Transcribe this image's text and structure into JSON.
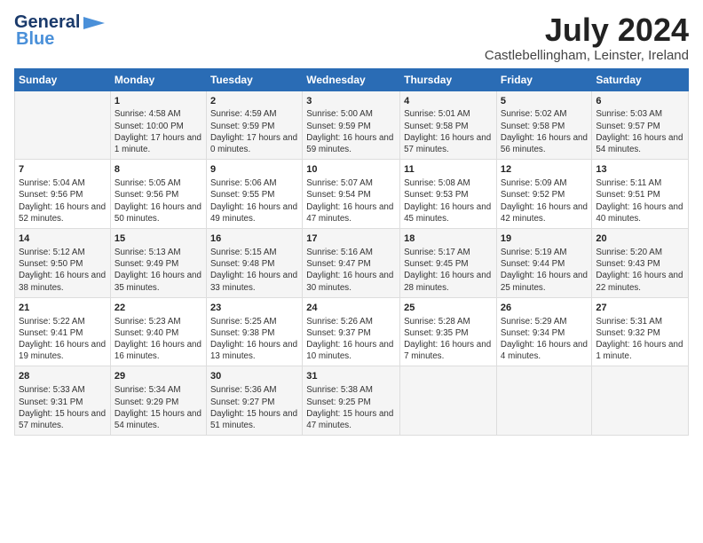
{
  "logo": {
    "line1": "General",
    "line2": "Blue"
  },
  "title": "July 2024",
  "subtitle": "Castlebellingham, Leinster, Ireland",
  "days_header": [
    "Sunday",
    "Monday",
    "Tuesday",
    "Wednesday",
    "Thursday",
    "Friday",
    "Saturday"
  ],
  "rows": [
    [
      {
        "day": "",
        "sunrise": "",
        "sunset": "",
        "daylight": ""
      },
      {
        "day": "1",
        "sunrise": "Sunrise: 4:58 AM",
        "sunset": "Sunset: 10:00 PM",
        "daylight": "Daylight: 17 hours and 1 minute."
      },
      {
        "day": "2",
        "sunrise": "Sunrise: 4:59 AM",
        "sunset": "Sunset: 9:59 PM",
        "daylight": "Daylight: 17 hours and 0 minutes."
      },
      {
        "day": "3",
        "sunrise": "Sunrise: 5:00 AM",
        "sunset": "Sunset: 9:59 PM",
        "daylight": "Daylight: 16 hours and 59 minutes."
      },
      {
        "day": "4",
        "sunrise": "Sunrise: 5:01 AM",
        "sunset": "Sunset: 9:58 PM",
        "daylight": "Daylight: 16 hours and 57 minutes."
      },
      {
        "day": "5",
        "sunrise": "Sunrise: 5:02 AM",
        "sunset": "Sunset: 9:58 PM",
        "daylight": "Daylight: 16 hours and 56 minutes."
      },
      {
        "day": "6",
        "sunrise": "Sunrise: 5:03 AM",
        "sunset": "Sunset: 9:57 PM",
        "daylight": "Daylight: 16 hours and 54 minutes."
      }
    ],
    [
      {
        "day": "7",
        "sunrise": "Sunrise: 5:04 AM",
        "sunset": "Sunset: 9:56 PM",
        "daylight": "Daylight: 16 hours and 52 minutes."
      },
      {
        "day": "8",
        "sunrise": "Sunrise: 5:05 AM",
        "sunset": "Sunset: 9:56 PM",
        "daylight": "Daylight: 16 hours and 50 minutes."
      },
      {
        "day": "9",
        "sunrise": "Sunrise: 5:06 AM",
        "sunset": "Sunset: 9:55 PM",
        "daylight": "Daylight: 16 hours and 49 minutes."
      },
      {
        "day": "10",
        "sunrise": "Sunrise: 5:07 AM",
        "sunset": "Sunset: 9:54 PM",
        "daylight": "Daylight: 16 hours and 47 minutes."
      },
      {
        "day": "11",
        "sunrise": "Sunrise: 5:08 AM",
        "sunset": "Sunset: 9:53 PM",
        "daylight": "Daylight: 16 hours and 45 minutes."
      },
      {
        "day": "12",
        "sunrise": "Sunrise: 5:09 AM",
        "sunset": "Sunset: 9:52 PM",
        "daylight": "Daylight: 16 hours and 42 minutes."
      },
      {
        "day": "13",
        "sunrise": "Sunrise: 5:11 AM",
        "sunset": "Sunset: 9:51 PM",
        "daylight": "Daylight: 16 hours and 40 minutes."
      }
    ],
    [
      {
        "day": "14",
        "sunrise": "Sunrise: 5:12 AM",
        "sunset": "Sunset: 9:50 PM",
        "daylight": "Daylight: 16 hours and 38 minutes."
      },
      {
        "day": "15",
        "sunrise": "Sunrise: 5:13 AM",
        "sunset": "Sunset: 9:49 PM",
        "daylight": "Daylight: 16 hours and 35 minutes."
      },
      {
        "day": "16",
        "sunrise": "Sunrise: 5:15 AM",
        "sunset": "Sunset: 9:48 PM",
        "daylight": "Daylight: 16 hours and 33 minutes."
      },
      {
        "day": "17",
        "sunrise": "Sunrise: 5:16 AM",
        "sunset": "Sunset: 9:47 PM",
        "daylight": "Daylight: 16 hours and 30 minutes."
      },
      {
        "day": "18",
        "sunrise": "Sunrise: 5:17 AM",
        "sunset": "Sunset: 9:45 PM",
        "daylight": "Daylight: 16 hours and 28 minutes."
      },
      {
        "day": "19",
        "sunrise": "Sunrise: 5:19 AM",
        "sunset": "Sunset: 9:44 PM",
        "daylight": "Daylight: 16 hours and 25 minutes."
      },
      {
        "day": "20",
        "sunrise": "Sunrise: 5:20 AM",
        "sunset": "Sunset: 9:43 PM",
        "daylight": "Daylight: 16 hours and 22 minutes."
      }
    ],
    [
      {
        "day": "21",
        "sunrise": "Sunrise: 5:22 AM",
        "sunset": "Sunset: 9:41 PM",
        "daylight": "Daylight: 16 hours and 19 minutes."
      },
      {
        "day": "22",
        "sunrise": "Sunrise: 5:23 AM",
        "sunset": "Sunset: 9:40 PM",
        "daylight": "Daylight: 16 hours and 16 minutes."
      },
      {
        "day": "23",
        "sunrise": "Sunrise: 5:25 AM",
        "sunset": "Sunset: 9:38 PM",
        "daylight": "Daylight: 16 hours and 13 minutes."
      },
      {
        "day": "24",
        "sunrise": "Sunrise: 5:26 AM",
        "sunset": "Sunset: 9:37 PM",
        "daylight": "Daylight: 16 hours and 10 minutes."
      },
      {
        "day": "25",
        "sunrise": "Sunrise: 5:28 AM",
        "sunset": "Sunset: 9:35 PM",
        "daylight": "Daylight: 16 hours and 7 minutes."
      },
      {
        "day": "26",
        "sunrise": "Sunrise: 5:29 AM",
        "sunset": "Sunset: 9:34 PM",
        "daylight": "Daylight: 16 hours and 4 minutes."
      },
      {
        "day": "27",
        "sunrise": "Sunrise: 5:31 AM",
        "sunset": "Sunset: 9:32 PM",
        "daylight": "Daylight: 16 hours and 1 minute."
      }
    ],
    [
      {
        "day": "28",
        "sunrise": "Sunrise: 5:33 AM",
        "sunset": "Sunset: 9:31 PM",
        "daylight": "Daylight: 15 hours and 57 minutes."
      },
      {
        "day": "29",
        "sunrise": "Sunrise: 5:34 AM",
        "sunset": "Sunset: 9:29 PM",
        "daylight": "Daylight: 15 hours and 54 minutes."
      },
      {
        "day": "30",
        "sunrise": "Sunrise: 5:36 AM",
        "sunset": "Sunset: 9:27 PM",
        "daylight": "Daylight: 15 hours and 51 minutes."
      },
      {
        "day": "31",
        "sunrise": "Sunrise: 5:38 AM",
        "sunset": "Sunset: 9:25 PM",
        "daylight": "Daylight: 15 hours and 47 minutes."
      },
      {
        "day": "",
        "sunrise": "",
        "sunset": "",
        "daylight": ""
      },
      {
        "day": "",
        "sunrise": "",
        "sunset": "",
        "daylight": ""
      },
      {
        "day": "",
        "sunrise": "",
        "sunset": "",
        "daylight": ""
      }
    ]
  ]
}
